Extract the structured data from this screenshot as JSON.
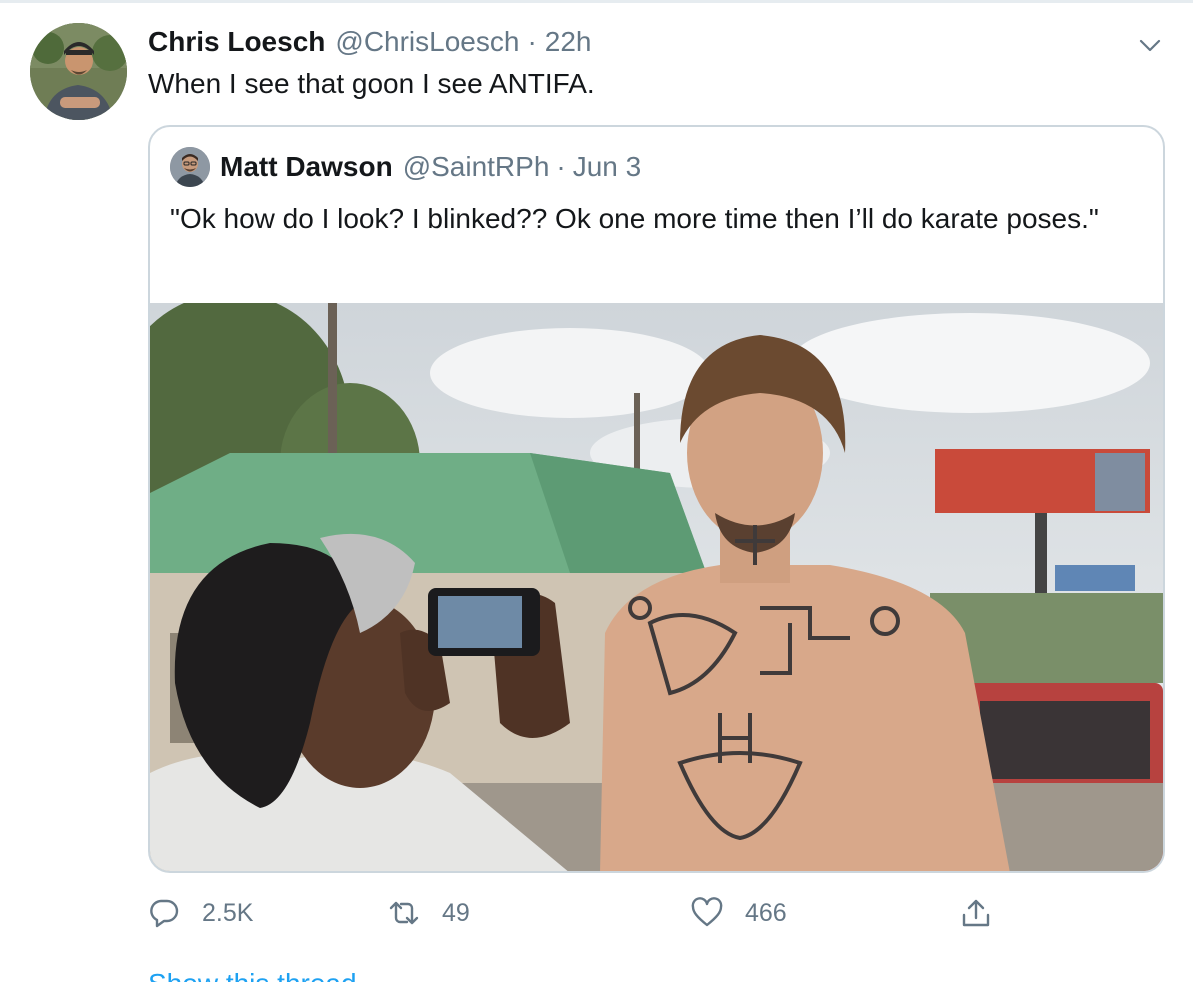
{
  "tweet": {
    "author_name": "Chris Loesch",
    "author_handle": "@ChrisLoesch",
    "separator": "·",
    "time": "22h",
    "text": "When I see that goon I see ANTIFA.",
    "avatar_icon": "profile-photo"
  },
  "quoted": {
    "author_name": "Matt Dawson",
    "author_handle": "@SaintRPh",
    "separator": "·",
    "date": "Jun 3",
    "text": "\"Ok how do I look? I blinked?? Ok one more time then I’ll do karate poses.\"",
    "avatar_icon": "profile-photo"
  },
  "media": {
    "icon": "photo",
    "sky_color": "#dfe3e6",
    "roof_color": "#6fae86",
    "billboard_color": "#c94a3a"
  },
  "actions": {
    "reply": {
      "icon": "reply-icon",
      "count": "2.5K"
    },
    "retweet": {
      "icon": "retweet-icon",
      "count": "49"
    },
    "like": {
      "icon": "heart-icon",
      "count": "466"
    },
    "share": {
      "icon": "share-icon"
    }
  },
  "footer": {
    "link_text": "Show this thread"
  },
  "colors": {
    "text": "#14171a",
    "secondary": "#657786",
    "border": "#ccd6dd",
    "link": "#1da1f2"
  }
}
